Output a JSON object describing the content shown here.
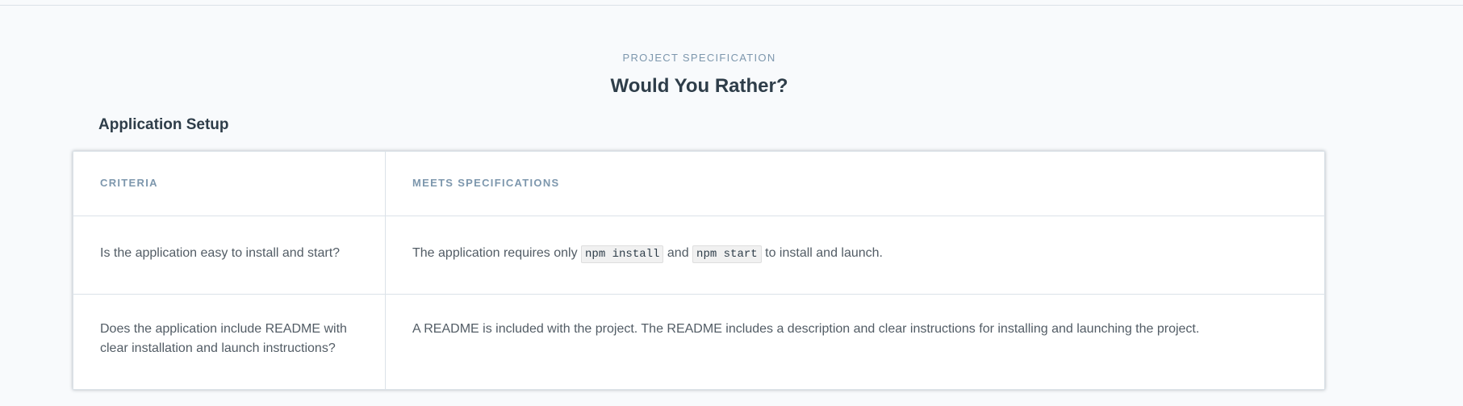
{
  "header": {
    "eyebrow": "PROJECT SPECIFICATION",
    "title": "Would You Rather?"
  },
  "section": {
    "title": "Application Setup"
  },
  "table": {
    "columns": {
      "criteria": "CRITERIA",
      "meets": "MEETS SPECIFICATIONS"
    },
    "rows": [
      {
        "criteria": "Is the application easy to install and start?",
        "meets_prefix": "The application requires only",
        "code1": "npm install",
        "meets_mid": "and",
        "code2": "npm start",
        "meets_suffix": "to install and launch."
      },
      {
        "criteria": "Does the application include README with clear installation and launch instructions?",
        "meets": "A README is included with the project. The README includes a description and clear instructions for installing and launching the project."
      }
    ]
  }
}
